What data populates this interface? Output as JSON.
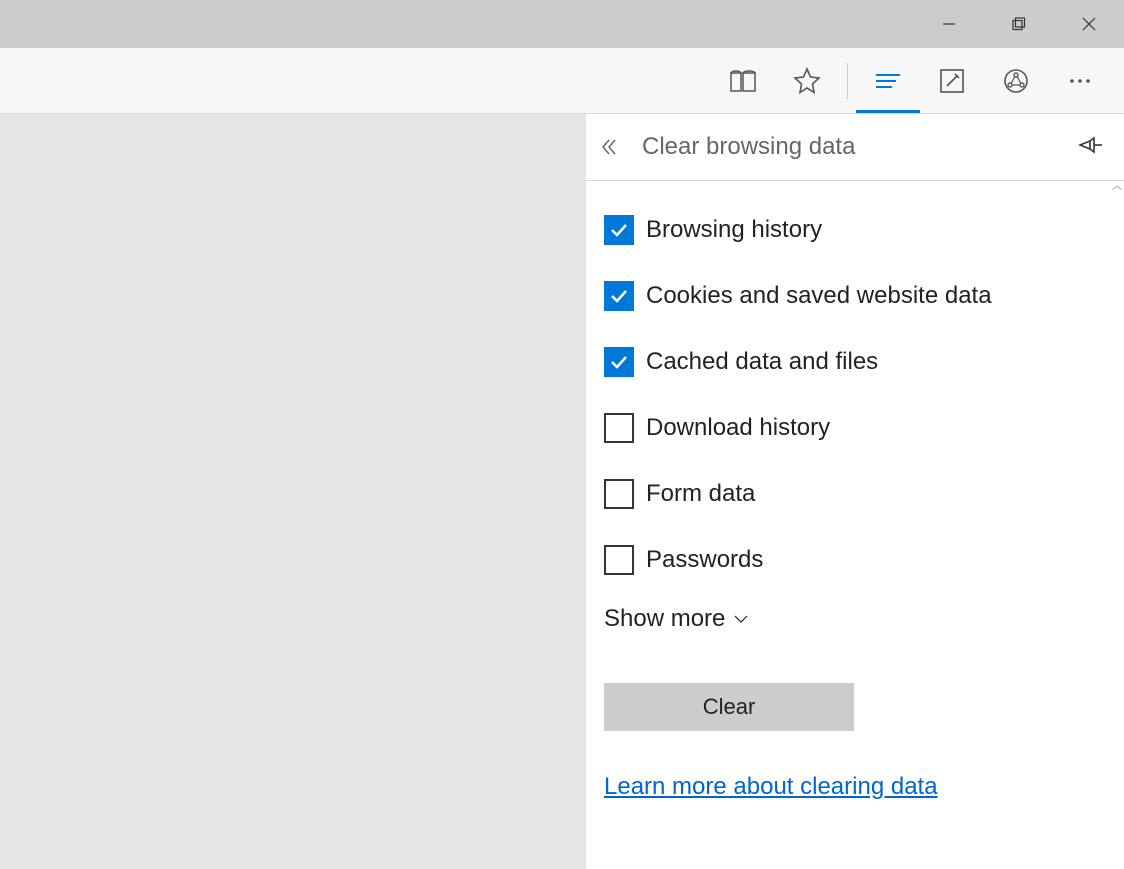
{
  "panel": {
    "title": "Clear browsing data",
    "show_more_label": "Show more",
    "clear_button_label": "Clear",
    "learn_more_label": "Learn more about clearing data",
    "items": [
      {
        "label": "Browsing history",
        "checked": true
      },
      {
        "label": "Cookies and saved website data",
        "checked": true
      },
      {
        "label": "Cached data and files",
        "checked": true
      },
      {
        "label": "Download history",
        "checked": false
      },
      {
        "label": "Form data",
        "checked": false
      },
      {
        "label": "Passwords",
        "checked": false
      }
    ]
  }
}
